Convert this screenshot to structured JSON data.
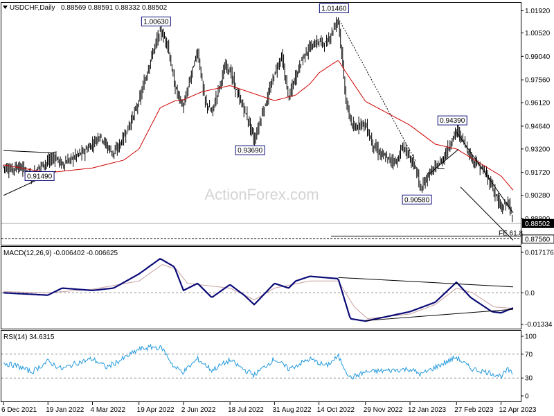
{
  "chart_data": {
    "type": "candlestick",
    "symbol_label": "USDCHF,Daily",
    "ohlc_values": [
      "0.88569",
      "0.88591",
      "0.88332",
      "0.88502"
    ],
    "watermark": "ActionForex.com",
    "current_price": 0.88502,
    "current_price_label": "0.88502",
    "y_range": [
      0.8716,
      1.0242
    ],
    "y_ticks": [
      {
        "value": 1.0192,
        "label": "1.01920"
      },
      {
        "value": 1.0052,
        "label": "1.00520"
      },
      {
        "value": 0.9904,
        "label": "0.99040"
      },
      {
        "value": 0.9756,
        "label": "0.97560"
      },
      {
        "value": 0.9612,
        "label": "0.96120"
      },
      {
        "value": 0.9464,
        "label": "0.94640"
      },
      {
        "value": 0.932,
        "label": "0.93200"
      },
      {
        "value": 0.9172,
        "label": "0.91720"
      },
      {
        "value": 0.9028,
        "label": "0.90280"
      },
      {
        "value": 0.888,
        "label": "0.88800"
      }
    ],
    "x_labels": [
      "6 Dec 2021",
      "19 Jan 2022",
      "4 Mar 2022",
      "19 Apr 2022",
      "2 Jun 2022",
      "18 Jul 2022",
      "31 Aug 2022",
      "14 Oct 2022",
      "29 Nov 2022",
      "12 Jan 2023",
      "27 Feb 2023",
      "12 Apr 2023"
    ],
    "price_anchors": [
      [
        "6 Dec 2021",
        0.921
      ],
      [
        "13 Dec 2021",
        0.919
      ],
      [
        "20 Dec 2021",
        0.921
      ],
      [
        "27 Dec 2021",
        0.9188
      ],
      [
        "3 Jan 2022",
        0.914
      ],
      [
        "10 Jan 2022",
        0.921
      ],
      [
        "19 Jan 2022",
        0.924
      ],
      [
        "26 Jan 2022",
        0.927
      ],
      [
        "2 Feb 2022",
        0.922
      ],
      [
        "9 Feb 2022",
        0.925
      ],
      [
        "16 Feb 2022",
        0.928
      ],
      [
        "23 Feb 2022",
        0.93
      ],
      [
        "4 Mar 2022",
        0.935
      ],
      [
        "11 Mar 2022",
        0.941
      ],
      [
        "18 Mar 2022",
        0.934
      ],
      [
        "25 Mar 2022",
        0.929
      ],
      [
        "1 Apr 2022",
        0.936
      ],
      [
        "8 Apr 2022",
        0.945
      ],
      [
        "19 Apr 2022",
        0.962
      ],
      [
        "26 Apr 2022",
        0.978
      ],
      [
        "3 May 2022",
        0.994
      ],
      [
        "10 May 2022",
        1.0063
      ],
      [
        "17 May 2022",
        0.999
      ],
      [
        "24 May 2022",
        0.972
      ],
      [
        "2 Jun 2022",
        0.958
      ],
      [
        "9 Jun 2022",
        0.978
      ],
      [
        "16 Jun 2022",
        0.994
      ],
      [
        "23 Jun 2022",
        0.962
      ],
      [
        "30 Jun 2022",
        0.955
      ],
      [
        "7 Jul 2022",
        0.971
      ],
      [
        "14 Jul 2022",
        0.985
      ],
      [
        "18 Jul 2022",
        0.981
      ],
      [
        "25 Jul 2022",
        0.967
      ],
      [
        "1 Aug 2022",
        0.957
      ],
      [
        "8 Aug 2022",
        0.9445
      ],
      [
        "11 Aug 2022",
        0.9369
      ],
      [
        "18 Aug 2022",
        0.953
      ],
      [
        "25 Aug 2022",
        0.966
      ],
      [
        "31 Aug 2022",
        0.98
      ],
      [
        "7 Sep 2022",
        0.9905
      ],
      [
        "14 Sep 2022",
        0.964
      ],
      [
        "21 Sep 2022",
        0.978
      ],
      [
        "28 Sep 2022",
        0.99
      ],
      [
        "5 Oct 2022",
        0.996
      ],
      [
        "14 Oct 2022",
        1.0
      ],
      [
        "21 Oct 2022",
        0.998
      ],
      [
        "2 Nov 2022",
        1.0146
      ],
      [
        "10 Nov 2022",
        0.96
      ],
      [
        "17 Nov 2022",
        0.944
      ],
      [
        "24 Nov 2022",
        0.949
      ],
      [
        "29 Nov 2022",
        0.947
      ],
      [
        "6 Dec 2022",
        0.935
      ],
      [
        "13 Dec 2022",
        0.929
      ],
      [
        "20 Dec 2022",
        0.926
      ],
      [
        "30 Dec 2022",
        0.924
      ],
      [
        "5 Jan 2023",
        0.934
      ],
      [
        "12 Jan 2023",
        0.926
      ],
      [
        "17 Jan 2023",
        0.9215
      ],
      [
        "23 Jan 2023",
        0.9058
      ],
      [
        "30 Jan 2023",
        0.916
      ],
      [
        "6 Feb 2023",
        0.92
      ],
      [
        "13 Feb 2023",
        0.925
      ],
      [
        "20 Feb 2023",
        0.934
      ],
      [
        "27 Feb 2023",
        0.9439
      ],
      [
        "6 Mar 2023",
        0.937
      ],
      [
        "13 Mar 2023",
        0.927
      ],
      [
        "20 Mar 2023",
        0.922
      ],
      [
        "27 Mar 2023",
        0.917
      ],
      [
        "3 Apr 2023",
        0.909
      ],
      [
        "12 Apr 2023",
        0.894
      ],
      [
        "19 Apr 2023",
        0.899
      ],
      [
        "24 Apr 2023",
        0.885
      ]
    ],
    "ma_anchors": [
      [
        "6 Dec 2021",
        0.922
      ],
      [
        "19 Jan 2022",
        0.917
      ],
      [
        "4 Mar 2022",
        0.92
      ],
      [
        "4 Apr 2022",
        0.925
      ],
      [
        "19 Apr 2022",
        0.932
      ],
      [
        "10 May 2022",
        0.958
      ],
      [
        "25 May 2022",
        0.9625
      ],
      [
        "2 Jun 2022",
        0.963
      ],
      [
        "20 Jun 2022",
        0.968
      ],
      [
        "18 Jul 2022",
        0.972
      ],
      [
        "31 Aug 2022",
        0.9625
      ],
      [
        "21 Sep 2022",
        0.966
      ],
      [
        "5 Oct 2022",
        0.973
      ],
      [
        "14 Oct 2022",
        0.98
      ],
      [
        "2 Nov 2022",
        0.988
      ],
      [
        "10 Nov 2022",
        0.98
      ],
      [
        "29 Nov 2022",
        0.962
      ],
      [
        "12 Jan 2023",
        0.947
      ],
      [
        "6 Feb 2023",
        0.935
      ],
      [
        "27 Feb 2023",
        0.932
      ],
      [
        "12 Apr 2023",
        0.915
      ],
      [
        "24 Apr 2023",
        0.906
      ]
    ],
    "price_boxes": [
      {
        "label": "1.00630",
        "date": "10 May 2022",
        "value": 1.0063,
        "pos": "above"
      },
      {
        "label": "1.01460",
        "date": "2 Nov 2022",
        "value": 1.0146,
        "pos": "above"
      },
      {
        "label": "0.93690",
        "date": "11 Aug 2022",
        "value": 0.9369,
        "pos": "below"
      },
      {
        "label": "0.94390",
        "date": "27 Feb 2023",
        "value": 0.9439,
        "pos": "above"
      },
      {
        "label": "0.90580",
        "date": "23 Jan 2023",
        "value": 0.9058,
        "pos": "below"
      },
      {
        "label": "0.91490",
        "date": "10 Jan 2022",
        "value": 0.9149,
        "pos": "center"
      }
    ],
    "support_label": "0.87560",
    "support_value": 0.8756,
    "fe_label": "FE 61.8",
    "trendlines": [
      {
        "style": "solid",
        "points": [
          [
            "6 Dec 2021",
            0.931
          ],
          [
            "27 Jan 2022",
            0.9295
          ]
        ]
      },
      {
        "style": "solid",
        "points": [
          [
            "6 Dec 2021",
            0.9027
          ],
          [
            "27 Jan 2022",
            0.918
          ]
        ]
      },
      {
        "style": "dotted",
        "points": [
          [
            "2 Nov 2022",
            1.0146
          ],
          [
            "18 Jan 2023",
            0.9238
          ]
        ]
      },
      {
        "style": "solid",
        "points": [
          [
            "27 Feb 2023",
            0.9425
          ],
          [
            "24 Apr 2023",
            0.8918
          ]
        ]
      },
      {
        "style": "solid",
        "points": [
          [
            "30 Jan 2023",
            0.9158
          ],
          [
            "1 Mar 2023",
            0.9318
          ]
        ]
      },
      {
        "style": "solid",
        "points": [
          [
            "8 Feb 2023",
            0.9195
          ],
          [
            "15 Feb 2023",
            0.9195
          ]
        ]
      },
      {
        "style": "solid",
        "points": [
          [
            "3 Mar 2023",
            0.908
          ],
          [
            "24 Apr 2023",
            0.8745
          ]
        ]
      }
    ],
    "macd": {
      "label": "MACD(12,26,9) -0.006402 -0.006625",
      "range": [
        -0.0152,
        0.0195
      ],
      "ticks": [
        {
          "value": 0.017176,
          "label": "0.017176"
        },
        {
          "value": 0.0,
          "label": "0.0"
        },
        {
          "value": -0.01334,
          "label": "-0.01334"
        }
      ],
      "zero_line": 0.0,
      "line_anchors": [
        [
          "6 Dec 2021",
          0.0
        ],
        [
          "19 Jan 2022",
          -0.001
        ],
        [
          "2 Feb 2022",
          0.002
        ],
        [
          "4 Mar 2022",
          0.001
        ],
        [
          "25 Mar 2022",
          0.002
        ],
        [
          "19 Apr 2022",
          0.008
        ],
        [
          "10 May 2022",
          0.0145
        ],
        [
          "24 May 2022",
          0.011
        ],
        [
          "2 Jun 2022",
          0.001
        ],
        [
          "16 Jun 2022",
          0.004
        ],
        [
          "30 Jun 2022",
          -0.002
        ],
        [
          "18 Jul 2022",
          0.0035
        ],
        [
          "1 Aug 2022",
          -0.001
        ],
        [
          "11 Aug 2022",
          -0.005
        ],
        [
          "31 Aug 2022",
          0.004
        ],
        [
          "14 Sep 2022",
          0.002
        ],
        [
          "21 Sep 2022",
          0.005
        ],
        [
          "5 Oct 2022",
          0.007
        ],
        [
          "2 Nov 2022",
          0.006
        ],
        [
          "14 Nov 2022",
          -0.011
        ],
        [
          "29 Nov 2022",
          -0.012
        ],
        [
          "12 Jan 2023",
          -0.008
        ],
        [
          "6 Feb 2023",
          -0.004
        ],
        [
          "27 Feb 2023",
          0.0045
        ],
        [
          "13 Mar 2023",
          -0.002
        ],
        [
          "3 Apr 2023",
          -0.008
        ],
        [
          "12 Apr 2023",
          -0.0085
        ],
        [
          "24 Apr 2023",
          -0.0064
        ]
      ],
      "signal_anchors": [
        [
          "6 Dec 2021",
          0.0005
        ],
        [
          "19 Jan 2022",
          0.0
        ],
        [
          "4 Mar 2022",
          0.0015
        ],
        [
          "19 Apr 2022",
          0.005
        ],
        [
          "12 May 2022",
          0.012
        ],
        [
          "26 May 2022",
          0.01
        ],
        [
          "6 Jun 2022",
          0.004
        ],
        [
          "18 Jul 2022",
          0.002
        ],
        [
          "11 Aug 2022",
          -0.003
        ],
        [
          "31 Aug 2022",
          0.002
        ],
        [
          "5 Oct 2022",
          0.005
        ],
        [
          "2 Nov 2022",
          0.005
        ],
        [
          "18 Nov 2022",
          -0.006
        ],
        [
          "1 Dec 2022",
          -0.011
        ],
        [
          "12 Jan 2023",
          -0.009
        ],
        [
          "6 Feb 2023",
          -0.005
        ],
        [
          "27 Feb 2023",
          0.002
        ],
        [
          "15 Mar 2023",
          0.0
        ],
        [
          "5 Apr 2023",
          -0.006
        ],
        [
          "24 Apr 2023",
          -0.0066
        ]
      ],
      "trendlines": [
        {
          "points": [
            [
              "2 Nov 2022",
              0.0065
            ],
            [
              "24 Apr 2023",
              0.0025
            ]
          ]
        },
        {
          "points": [
            [
              "29 Nov 2022",
              -0.0118
            ],
            [
              "24 Apr 2023",
              -0.007
            ]
          ]
        }
      ]
    },
    "rsi": {
      "label": "RSI(14) 34.6315",
      "range": [
        0,
        100
      ],
      "ticks": [
        {
          "value": 100,
          "label": "100"
        },
        {
          "value": 70,
          "label": "70"
        },
        {
          "value": 30,
          "label": "30"
        },
        {
          "value": 0,
          "label": "0"
        }
      ],
      "levels": [
        70,
        30
      ],
      "anchors": [
        [
          "6 Dec 2021",
          55
        ],
        [
          "20 Dec 2021",
          50
        ],
        [
          "3 Jan 2022",
          40
        ],
        [
          "19 Jan 2022",
          58
        ],
        [
          "2 Feb 2022",
          45
        ],
        [
          "16 Feb 2022",
          55
        ],
        [
          "4 Mar 2022",
          62
        ],
        [
          "18 Mar 2022",
          48
        ],
        [
          "1 Apr 2022",
          60
        ],
        [
          "19 Apr 2022",
          78
        ],
        [
          "3 May 2022",
          82
        ],
        [
          "12 May 2022",
          80
        ],
        [
          "24 May 2022",
          48
        ],
        [
          "2 Jun 2022",
          40
        ],
        [
          "16 Jun 2022",
          62
        ],
        [
          "30 Jun 2022",
          43
        ],
        [
          "18 Jul 2022",
          60
        ],
        [
          "1 Aug 2022",
          44
        ],
        [
          "11 Aug 2022",
          35
        ],
        [
          "31 Aug 2022",
          62
        ],
        [
          "14 Sep 2022",
          45
        ],
        [
          "5 Oct 2022",
          62
        ],
        [
          "21 Oct 2022",
          50
        ],
        [
          "2 Nov 2022",
          66
        ],
        [
          "14 Nov 2022",
          30
        ],
        [
          "29 Nov 2022",
          40
        ],
        [
          "12 Jan 2023",
          45
        ],
        [
          "23 Jan 2023",
          36
        ],
        [
          "6 Feb 2023",
          48
        ],
        [
          "27 Feb 2023",
          65
        ],
        [
          "13 Mar 2023",
          46
        ],
        [
          "3 Apr 2023",
          38
        ],
        [
          "12 Apr 2023",
          33
        ],
        [
          "19 Apr 2023",
          44
        ],
        [
          "24 Apr 2023",
          34.6
        ]
      ]
    },
    "colors": {
      "candle": "#000000",
      "moving_average": "#d00000",
      "macd_line": "#0a0a78",
      "macd_signal": "#c8a0a0",
      "rsi_line": "#2299dd",
      "box_border": "#0a0a78",
      "grid_dash": "#8c8c8c"
    }
  }
}
